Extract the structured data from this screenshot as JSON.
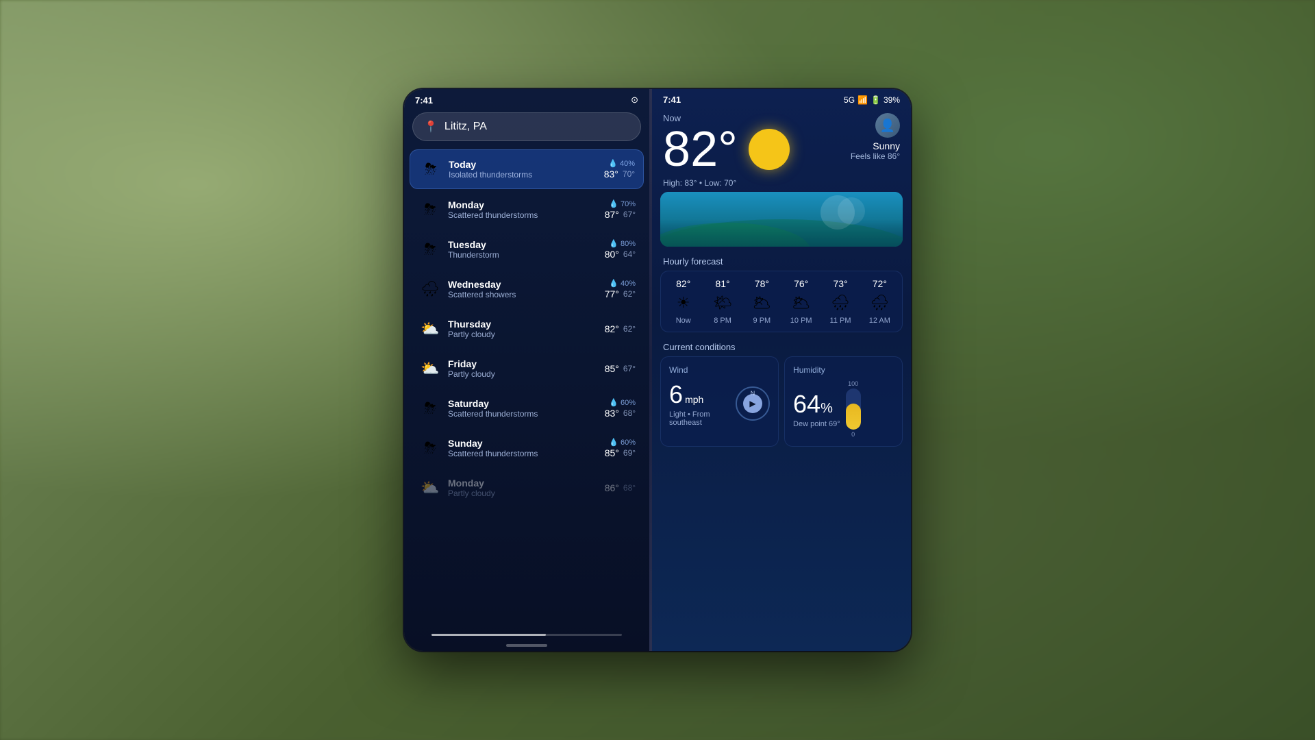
{
  "left": {
    "status": {
      "time": "7:41",
      "network_icon": "⊙"
    },
    "search": {
      "location": "Lititz, PA"
    },
    "forecast": [
      {
        "day": "Today",
        "condition": "Isolated thunderstorms",
        "icon": "⛈",
        "high": "83°",
        "low": "70°",
        "precip": "40%",
        "active": true,
        "showPrecip": true
      },
      {
        "day": "Monday",
        "condition": "Scattered thunderstorms",
        "icon": "⛈",
        "high": "87°",
        "low": "67°",
        "precip": "70%",
        "active": false,
        "showPrecip": true
      },
      {
        "day": "Tuesday",
        "condition": "Thunderstorm",
        "icon": "⛈",
        "high": "80°",
        "low": "64°",
        "precip": "80%",
        "active": false,
        "showPrecip": true
      },
      {
        "day": "Wednesday",
        "condition": "Scattered showers",
        "icon": "🌧",
        "high": "77°",
        "low": "62°",
        "precip": "40%",
        "active": false,
        "showPrecip": true
      },
      {
        "day": "Thursday",
        "condition": "Partly cloudy",
        "icon": "⛅",
        "high": "82°",
        "low": "62°",
        "precip": "",
        "active": false,
        "showPrecip": false
      },
      {
        "day": "Friday",
        "condition": "Partly cloudy",
        "icon": "⛅",
        "high": "85°",
        "low": "67°",
        "precip": "",
        "active": false,
        "showPrecip": false
      },
      {
        "day": "Saturday",
        "condition": "Scattered thunderstorms",
        "icon": "⛈",
        "high": "83°",
        "low": "68°",
        "precip": "60%",
        "active": false,
        "showPrecip": true
      },
      {
        "day": "Sunday",
        "condition": "Scattered thunderstorms",
        "icon": "⛈",
        "high": "85°",
        "low": "69°",
        "precip": "60%",
        "active": false,
        "showPrecip": true
      },
      {
        "day": "Monday",
        "condition": "Partly cloudy",
        "icon": "⛅",
        "high": "86°",
        "low": "68°",
        "precip": "",
        "active": false,
        "showPrecip": false,
        "dimmed": true
      }
    ]
  },
  "right": {
    "status": {
      "time": "7:41",
      "signal": "5G",
      "battery": "39%"
    },
    "current": {
      "label": "Now",
      "temperature": "82°",
      "condition": "Sunny",
      "feels_like": "Feels like 86°",
      "high": "83°",
      "low": "70°"
    },
    "hourly": {
      "title": "Hourly forecast",
      "items": [
        {
          "time": "Now",
          "temp": "82°",
          "icon": "☀"
        },
        {
          "time": "8 PM",
          "temp": "81°",
          "icon": "🌤"
        },
        {
          "time": "9 PM",
          "temp": "78°",
          "icon": "🌥"
        },
        {
          "time": "10 PM",
          "temp": "76°",
          "icon": "🌥"
        },
        {
          "time": "11 PM",
          "temp": "73°",
          "icon": "🌧"
        },
        {
          "time": "12 AM",
          "temp": "72°",
          "icon": "🌧"
        }
      ]
    },
    "conditions": {
      "title": "Current conditions",
      "wind": {
        "title": "Wind",
        "speed": "6",
        "unit": "mph",
        "description": "Light • From southeast",
        "direction": "N"
      },
      "humidity": {
        "title": "Humidity",
        "value": "64",
        "dew_point": "Dew point 69°",
        "bar_fill_pct": 64,
        "bar_max": 100,
        "bar_zero": 0
      }
    }
  }
}
